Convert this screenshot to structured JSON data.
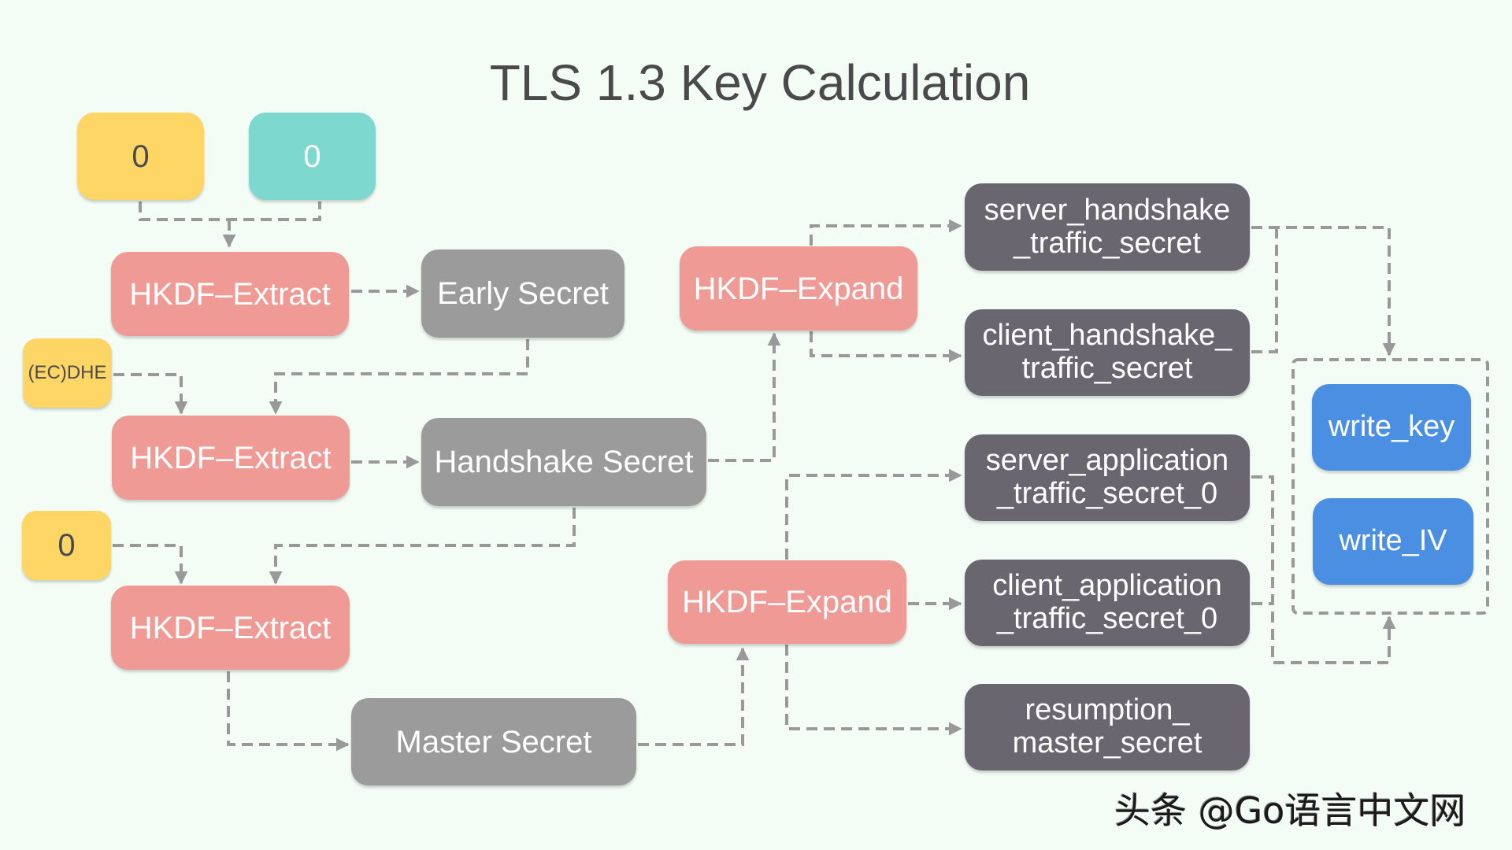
{
  "title": "TLS 1.3 Key Calculation",
  "colors": {
    "background": "#f3fdf6",
    "input_yellow": "#fdd666",
    "input_teal": "#7dd8cf",
    "hkdf_function": "#f09a96",
    "secret_gray": "#9b9b9b",
    "traffic_secret_dark": "#6a6670",
    "key_blue": "#4a8fe2",
    "connector": "#999999"
  },
  "inputs": {
    "zero_psk": "0",
    "zero_salt": "0",
    "ecdhe": "(EC)DHE",
    "zero_master": "0"
  },
  "functions": {
    "extract_early": "HKDF–Extract",
    "extract_handshake": "HKDF–Extract",
    "extract_master": "HKDF–Extract",
    "expand_handshake": "HKDF–Expand",
    "expand_application": "HKDF–Expand"
  },
  "secrets": {
    "early": "Early Secret",
    "handshake": "Handshake Secret",
    "master": "Master Secret"
  },
  "traffic_secrets": {
    "server_handshake": [
      "server_handshake",
      "_traffic_secret"
    ],
    "client_handshake": [
      "client_handshake_",
      "traffic_secret"
    ],
    "server_application": [
      "server_application",
      "_traffic_secret_0"
    ],
    "client_application": [
      "client_application",
      "_traffic_secret_0"
    ],
    "resumption": [
      "resumption_",
      "master_secret"
    ]
  },
  "keys": {
    "write_key": "write_key",
    "write_iv": "write_IV"
  },
  "watermark": "头条 @Go语言中文网",
  "edges": [
    {
      "from": "zero_psk",
      "to": "extract_early"
    },
    {
      "from": "zero_salt",
      "to": "extract_early"
    },
    {
      "from": "extract_early",
      "to": "early"
    },
    {
      "from": "early",
      "to": "extract_handshake"
    },
    {
      "from": "ecdhe",
      "to": "extract_handshake"
    },
    {
      "from": "extract_handshake",
      "to": "handshake"
    },
    {
      "from": "handshake",
      "to": "expand_handshake"
    },
    {
      "from": "handshake",
      "to": "extract_master"
    },
    {
      "from": "zero_master",
      "to": "extract_master"
    },
    {
      "from": "extract_master",
      "to": "master"
    },
    {
      "from": "master",
      "to": "expand_application"
    },
    {
      "from": "expand_handshake",
      "to": "server_handshake"
    },
    {
      "from": "expand_handshake",
      "to": "client_handshake"
    },
    {
      "from": "expand_application",
      "to": "server_application"
    },
    {
      "from": "expand_application",
      "to": "client_application"
    },
    {
      "from": "expand_application",
      "to": "resumption"
    },
    {
      "from": "server_handshake",
      "to": "key_group"
    },
    {
      "from": "client_handshake",
      "to": "key_group"
    },
    {
      "from": "server_application",
      "to": "key_group"
    },
    {
      "from": "client_application",
      "to": "key_group"
    }
  ]
}
